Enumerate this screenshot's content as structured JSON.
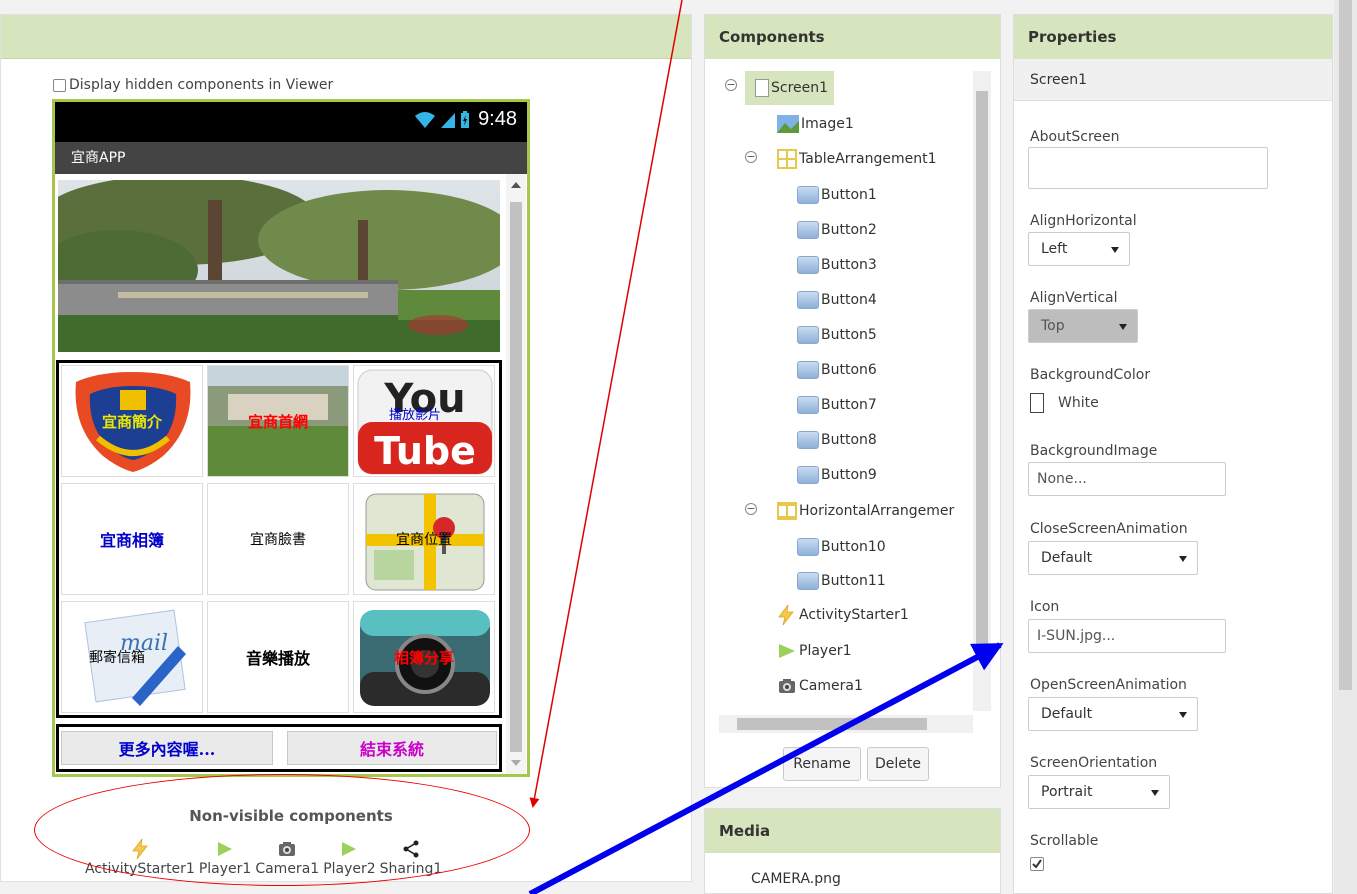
{
  "viewer": {
    "hidden_components_label": "Display hidden components in Viewer",
    "status_time": "9:48",
    "app_title": "宜商APP",
    "grid_buttons": [
      {
        "label": "宜商簡介",
        "color": "#e8e800"
      },
      {
        "label": "宜商首網",
        "color": "#ff0000"
      },
      {
        "label": "播放影片",
        "color": "#0000cc"
      },
      {
        "label": "宜商相簿",
        "color": "#0000cc"
      },
      {
        "label": "宜商臉書",
        "color": "#000000"
      },
      {
        "label": "宜商位置",
        "color": "#000000"
      },
      {
        "label": "郵寄信箱",
        "color": "#000000"
      },
      {
        "label": "音樂播放",
        "color": "#000000"
      },
      {
        "label": "相簿分享",
        "color": "#ff0000"
      }
    ],
    "youtube_logo": {
      "top": "You",
      "bottom": "Tube"
    },
    "bottom_buttons": [
      {
        "label": "更多內容喔...",
        "color": "#0000cc"
      },
      {
        "label": "結束系統",
        "color": "#cc00cc"
      }
    ],
    "nonvisible_title": "Non-visible components",
    "nonvisible": [
      {
        "label": "ActivityStarter1",
        "icon": "lightning-icon"
      },
      {
        "label": "Player1",
        "icon": "play-icon"
      },
      {
        "label": "Camera1",
        "icon": "camera-icon"
      },
      {
        "label": "Player2",
        "icon": "play-icon"
      },
      {
        "label": "Sharing1",
        "icon": "share-icon"
      }
    ]
  },
  "components": {
    "title": "Components",
    "tree": {
      "screen": "Screen1",
      "image": "Image1",
      "table": "TableArrangement1",
      "table_buttons": [
        "Button1",
        "Button2",
        "Button3",
        "Button4",
        "Button5",
        "Button6",
        "Button7",
        "Button8",
        "Button9"
      ],
      "horizontal": "HorizontalArrangemer",
      "horizontal_buttons": [
        "Button10",
        "Button11"
      ],
      "activity": "ActivityStarter1",
      "player": "Player1",
      "camera": "Camera1"
    },
    "rename_label": "Rename",
    "delete_label": "Delete"
  },
  "media": {
    "title": "Media",
    "files": [
      "CAMERA.png"
    ]
  },
  "properties": {
    "title": "Properties",
    "component": "Screen1",
    "about_label": "AboutScreen",
    "about_value": "",
    "align_h_label": "AlignHorizontal",
    "align_h_value": "Left",
    "align_v_label": "AlignVertical",
    "align_v_value": "Top",
    "bg_color_label": "BackgroundColor",
    "bg_color_value": "White",
    "bg_image_label": "BackgroundImage",
    "bg_image_value": "None...",
    "close_anim_label": "CloseScreenAnimation",
    "close_anim_value": "Default",
    "icon_label": "Icon",
    "icon_value": "I-SUN.jpg...",
    "open_anim_label": "OpenScreenAnimation",
    "open_anim_value": "Default",
    "orientation_label": "ScreenOrientation",
    "orientation_value": "Portrait",
    "scrollable_label": "Scrollable",
    "scrollable_checked": true
  },
  "colors": {
    "panel_header": "#d7e5be",
    "phone_border": "#a5c84a",
    "annotation_red": "#e00000",
    "annotation_blue": "#0000ee"
  }
}
